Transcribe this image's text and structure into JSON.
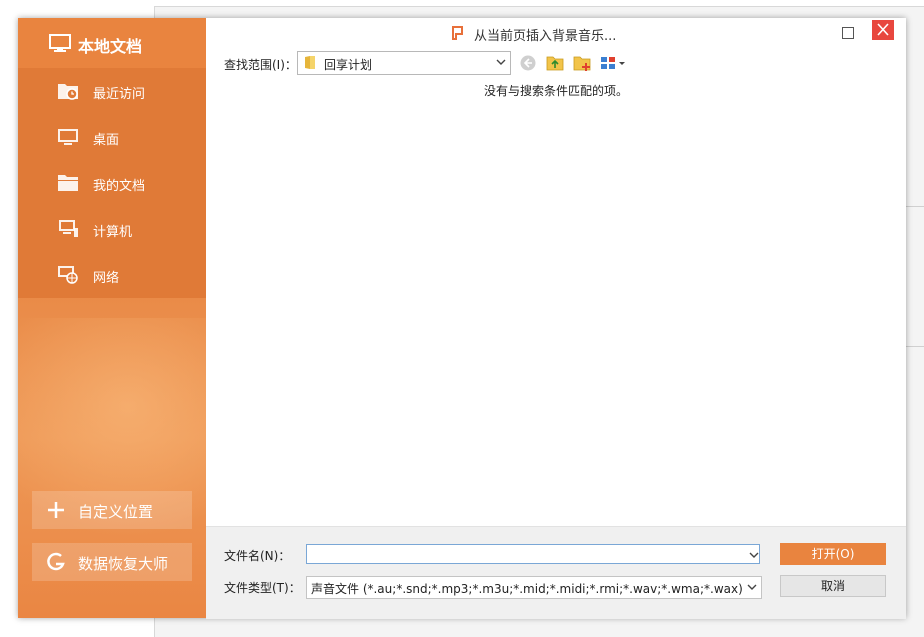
{
  "dialog": {
    "title": "从当前页插入背景音乐..."
  },
  "sidebar": {
    "header": "本地文档",
    "items": [
      {
        "label": "最近访问"
      },
      {
        "label": "桌面"
      },
      {
        "label": "我的文档"
      },
      {
        "label": "计算机"
      },
      {
        "label": "网络"
      }
    ],
    "custom_location_label": "自定义位置",
    "recovery_label": "数据恢复大师"
  },
  "toolbar": {
    "lookin_label": "查找范围(I)：",
    "lookin_value": "回享计划"
  },
  "content": {
    "empty_message": "没有与搜索条件匹配的项。"
  },
  "footer": {
    "filename_label": "文件名(N)：",
    "filename_value": "",
    "filetype_label": "文件类型(T)：",
    "filetype_value": "声音文件 (*.au;*.snd;*.mp3;*.m3u;*.mid;*.midi;*.rmi;*.wav;*.wma;*.wax)",
    "open_label": "打开(O)",
    "cancel_label": "取消"
  },
  "colors": {
    "accent": "#e9843f",
    "sidebar_nav": "#e07a37",
    "close_button": "#e8473e"
  },
  "icons": {
    "app": "wps-presentation-icon",
    "back": "back-arrow-icon",
    "up": "folder-up-icon",
    "new_folder": "new-folder-icon",
    "view": "view-menu-icon"
  }
}
